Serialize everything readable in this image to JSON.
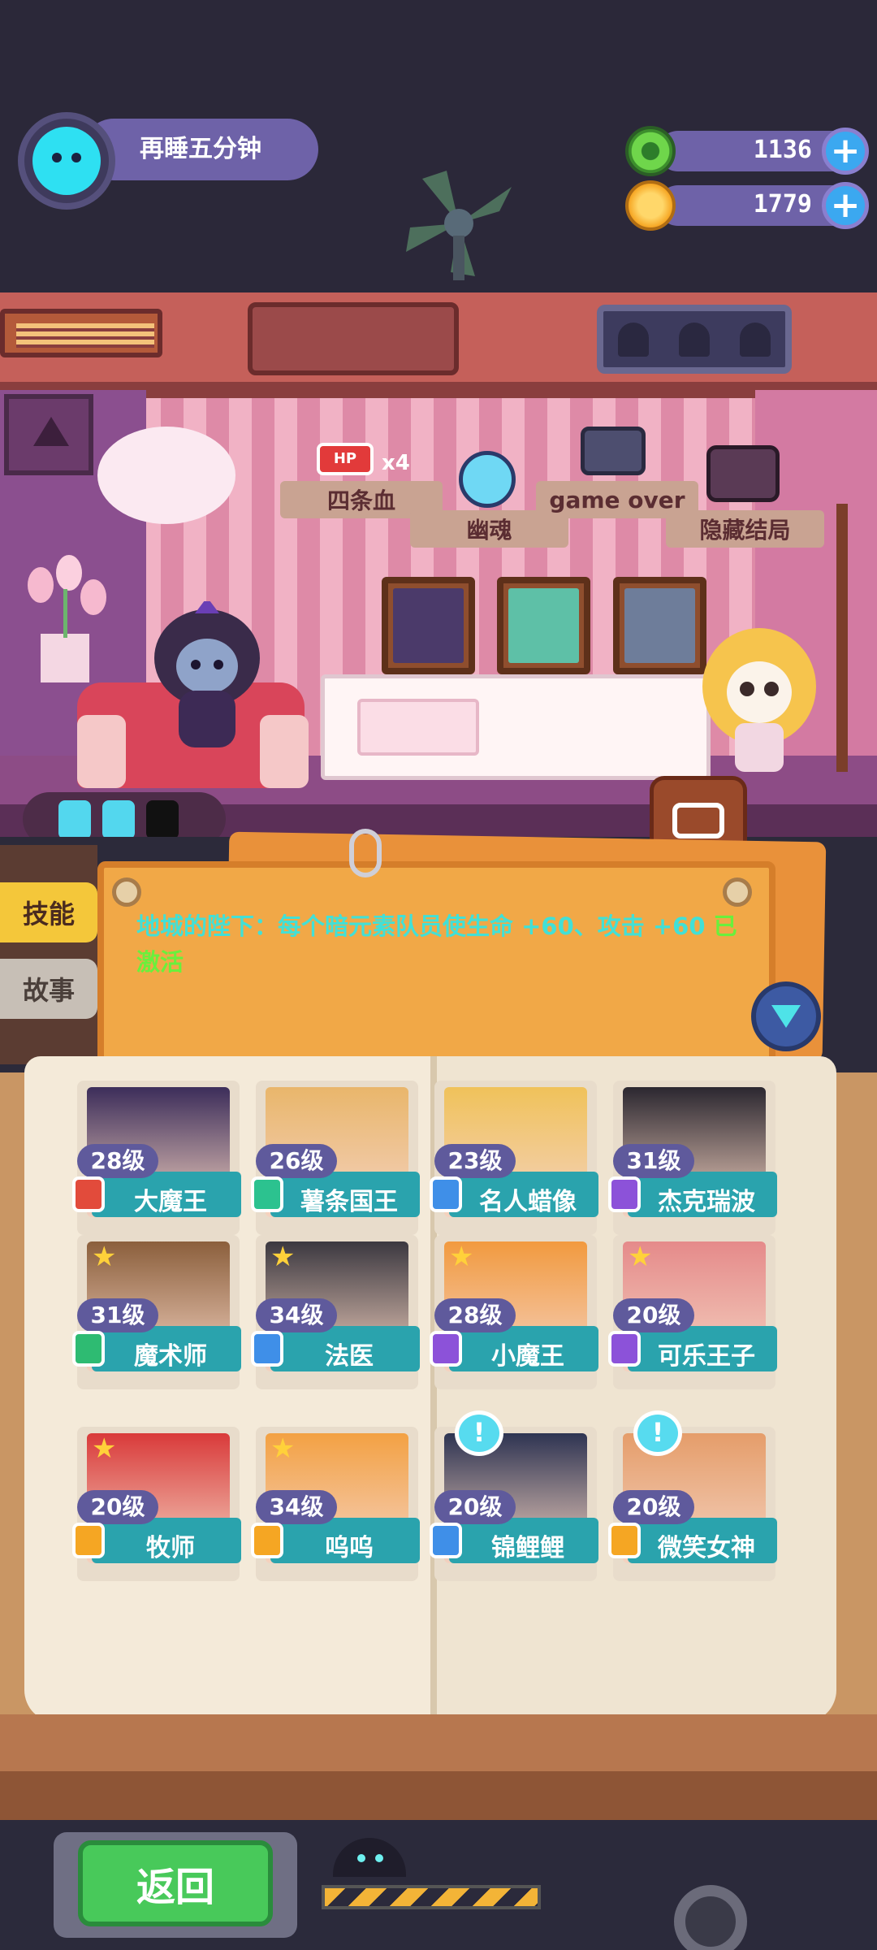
{
  "player": {
    "name": "再睡五分钟"
  },
  "currency": {
    "gems": "1136",
    "coins": "1779",
    "add_label": "+"
  },
  "endings": [
    {
      "label": "四条血",
      "badge": "x4"
    },
    {
      "label": "幽魂"
    },
    {
      "label": "game over"
    },
    {
      "label": "隐藏结局"
    }
  ],
  "hp_tag": "HP",
  "tabs": {
    "skill": "技能",
    "story": "故事"
  },
  "skill_note": {
    "text": "地城的陛下：每个暗元素队员使生命 +60、攻击 +60",
    "status": "已激活"
  },
  "characters": [
    {
      "level": "28级",
      "name": "大魔王",
      "element_color": "#e24b3b",
      "art_color": "#3c2d5a",
      "star": false,
      "alert": false
    },
    {
      "level": "26级",
      "name": "薯条国王",
      "element_color": "#2cc28f",
      "art_color": "#e9b66b",
      "star": false,
      "alert": false
    },
    {
      "level": "23级",
      "name": "名人蜡像",
      "element_color": "#3f8fe8",
      "art_color": "#f0c25a",
      "star": false,
      "alert": false
    },
    {
      "level": "31级",
      "name": "杰克瑞波",
      "element_color": "#8c52d9",
      "art_color": "#2b2730",
      "star": false,
      "alert": false
    },
    {
      "level": "31级",
      "name": "魔术师",
      "element_color": "#2ebb72",
      "art_color": "#8b5f3c",
      "star": true,
      "alert": false
    },
    {
      "level": "34级",
      "name": "法医",
      "element_color": "#3f8fe8",
      "art_color": "#3b3840",
      "star": true,
      "alert": false
    },
    {
      "level": "28级",
      "name": "小魔王",
      "element_color": "#8c52d9",
      "art_color": "#f29a3f",
      "star": true,
      "alert": false
    },
    {
      "level": "20级",
      "name": "可乐王子",
      "element_color": "#8c52d9",
      "art_color": "#e58a8a",
      "star": true,
      "alert": false
    },
    {
      "level": "20级",
      "name": "牧师",
      "element_color": "#f5a623",
      "art_color": "#d93a3a",
      "star": true,
      "alert": false
    },
    {
      "level": "34级",
      "name": "呜呜",
      "element_color": "#f5a623",
      "art_color": "#f3a143",
      "star": true,
      "alert": false
    },
    {
      "level": "20级",
      "name": "锦鲤鲤",
      "element_color": "#3f8fe8",
      "art_color": "#2e3452",
      "star": false,
      "alert": true
    },
    {
      "level": "20级",
      "name": "微笑女神",
      "element_color": "#f5a623",
      "art_color": "#e59d6a",
      "star": false,
      "alert": true
    }
  ],
  "back_button": "返回",
  "colors": {
    "accent_teal": "#2aa3ad",
    "note_text": "#42e0d6",
    "note_active": "#6af03c",
    "skill_tab": "#f4c73a"
  }
}
